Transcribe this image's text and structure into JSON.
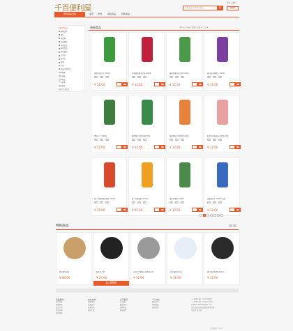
{
  "header": {
    "logo_text": "千百便利屋",
    "search_placeholder": "搜索商品 您想要的商品",
    "search_button": "Q",
    "top_links": "登录 | 注册",
    "cart_label": "购物车"
  },
  "nav": {
    "categories_label": "所有商品分类",
    "items": [
      "首页",
      "饮料",
      "最新商品",
      "特色商品"
    ]
  },
  "sidebar": {
    "items": [
      {
        "label": "饮料/饮品/水",
        "highlight": true,
        "arrow": ""
      },
      {
        "label": "碳酸饮料",
        "check": true
      },
      {
        "label": "果汁",
        "check": true
      },
      {
        "label": "茶饮料",
        "check": true
      },
      {
        "label": "功能饮料",
        "check": true
      },
      {
        "label": "乳制饮品",
        "check": true
      },
      {
        "label": "植物饮品",
        "check": true
      },
      {
        "label": "咖啡饮料",
        "check": true
      },
      {
        "label": "矿泉水",
        "check": true
      },
      {
        "label": "纯净水",
        "check": true
      },
      {
        "label": "啤酒",
        "check": true
      },
      {
        "label": "冲调",
        "check": true
      },
      {
        "label": "速溶冲调饮品",
        "check": true
      },
      {
        "label": "休闲零食",
        "arrow": "›"
      },
      {
        "label": "粮油调味",
        "arrow": "›"
      },
      {
        "label": "生鲜食品",
        "arrow": "›"
      },
      {
        "label": "个人护理",
        "arrow": "›"
      },
      {
        "label": "家居清洁",
        "arrow": "›"
      },
      {
        "label": "厨房/生活用品",
        "arrow": "›"
      }
    ]
  },
  "main": {
    "title": "所有商品",
    "sort_label": "排序方式  价格 ▾  销量 ▾  品牌 ▾  上/下 ◂▸",
    "tag_labels": [
      "规",
      "格",
      "收"
    ],
    "products": [
      {
        "name": "雪碧柠檬汽水 500ML",
        "price": "¥ 12.00",
        "color": "#3c9b3a"
      },
      {
        "name": "雪菲碳酸果汁饮料 500ML",
        "price": "¥ 12.00",
        "color": "#c0203a"
      },
      {
        "name": "康师傅果粒冰红茶 500ML",
        "price": "¥ 12.00",
        "color": "#4a9a4a"
      },
      {
        "name": "味丹阳光葡萄汁 480ML",
        "price": "¥ 12.00",
        "color": "#7b3fa0"
      },
      {
        "name": "黑松沙士 500ML",
        "price": "¥ 12.00",
        "color": "#3d7d3d"
      },
      {
        "name": "康师傅大亨乳饮料组合装",
        "price": "¥ 12.00",
        "color": "#3a8a4a"
      },
      {
        "name": "康师傅冰红茶饮料 500ML",
        "price": "¥ 12.00",
        "color": "#e8823a"
      },
      {
        "name": "娃哈哈营养快线 200ML 6瓶",
        "price": "¥ 12.00",
        "color": "#e8a0a0"
      },
      {
        "name": "统一鲜橙多橙汁果饮 500ML",
        "price": "¥ 12.00",
        "color": "#d84a2a"
      },
      {
        "name": "统一冰糖雪梨 500ML",
        "price": "¥ 12.00",
        "color": "#f0a020"
      },
      {
        "name": "维他柠檬茶 500ML",
        "price": "¥ 12.00",
        "color": "#4a8a4a"
      },
      {
        "name": "雀巢纯净水 550ML 瓶装",
        "price": "¥ 12.00",
        "color": "#3a6ac0"
      }
    ],
    "pager": [
      "<",
      "1",
      "2",
      "3",
      "4",
      "5",
      ">"
    ]
  },
  "featured": {
    "title": "特色商品",
    "products": [
      {
        "name": "榉木圆形砧板",
        "price": "¥ 88.00",
        "color": "#c9a06a"
      },
      {
        "name": "厨房电子秤",
        "price": "¥ 24.00",
        "color": "#222222",
        "add_to_cart": "加入购物车"
      },
      {
        "name": "苏泊尔不锈钢火锅汤锅二层",
        "price": "¥ 12.00",
        "color": "#9a9a9a"
      },
      {
        "name": "多芬滋润洗手液",
        "price": "¥ 12.00",
        "color": "#e8eef8"
      },
      {
        "name": "康宁陶瓷煲汤砂锅 2.5L",
        "price": "¥ 12.00",
        "color": "#2a2a2a"
      }
    ]
  },
  "footer": {
    "cols": [
      {
        "title": "新品抢鲜",
        "items": [
          "新手指南",
          "购物流程",
          "会员介绍",
          "常见问题",
          "联系客服"
        ]
      },
      {
        "title": "支付方式",
        "items": [
          "货到付款",
          "在线支付",
          "分期付款",
          "邮局汇款"
        ]
      },
      {
        "title": "关于我们",
        "items": [
          "公司简介",
          "联系我们",
          "招聘信息",
          "隐私政策"
        ]
      },
      {
        "title": "个人中心",
        "items": [
          "我的订单",
          "我的收藏",
          "修改资料"
        ]
      }
    ],
    "contact": [
      "☏ 0800-88 - 7236 (免费)",
      "☏ 0800-88 - 7236 / 7235",
      "✉ 0800-887236@qq.com",
      "浙江省温州市某区某路某某大厦",
      "某某号 某某室"
    ],
    "copyright": "千百便利屋 ©2015"
  }
}
